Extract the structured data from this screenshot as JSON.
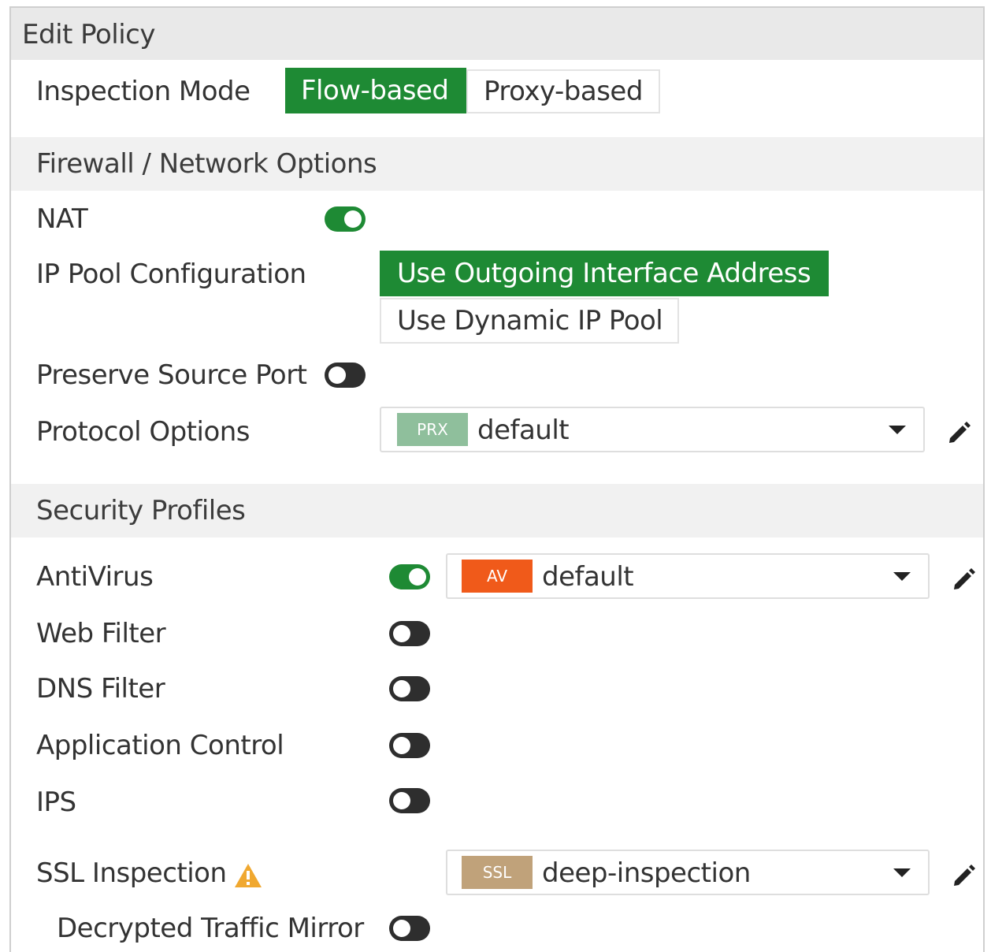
{
  "title": "Edit Policy",
  "inspection_mode": {
    "label": "Inspection Mode",
    "options": [
      "Flow-based",
      "Proxy-based"
    ],
    "selected": "Flow-based"
  },
  "firewall_section": {
    "title": "Firewall / Network Options",
    "nat": {
      "label": "NAT",
      "enabled": true
    },
    "ip_pool": {
      "label": "IP Pool Configuration",
      "options": [
        "Use Outgoing Interface Address",
        "Use Dynamic IP Pool"
      ],
      "selected": "Use Outgoing Interface Address"
    },
    "preserve_source_port": {
      "label": "Preserve Source Port",
      "enabled": false
    },
    "protocol_options": {
      "label": "Protocol Options",
      "badge": "PRX",
      "value": "default"
    }
  },
  "security_section": {
    "title": "Security Profiles",
    "antivirus": {
      "label": "AntiVirus",
      "enabled": true,
      "badge": "AV",
      "value": "default"
    },
    "web_filter": {
      "label": "Web Filter",
      "enabled": false
    },
    "dns_filter": {
      "label": "DNS Filter",
      "enabled": false
    },
    "application_control": {
      "label": "Application Control",
      "enabled": false
    },
    "ips": {
      "label": "IPS",
      "enabled": false
    },
    "ssl_inspection": {
      "label": "SSL Inspection",
      "badge": "SSL",
      "value": "deep-inspection",
      "warning_icon": "warning-icon"
    },
    "decrypted_traffic_mirror": {
      "label": "Decrypted Traffic Mirror",
      "enabled": false
    }
  },
  "colors": {
    "active_green": "#1e8a34",
    "prx_badge": "#8fbf9c",
    "av_badge": "#f05a1a",
    "ssl_badge": "#c0a27a",
    "warning": "#f0a830"
  }
}
